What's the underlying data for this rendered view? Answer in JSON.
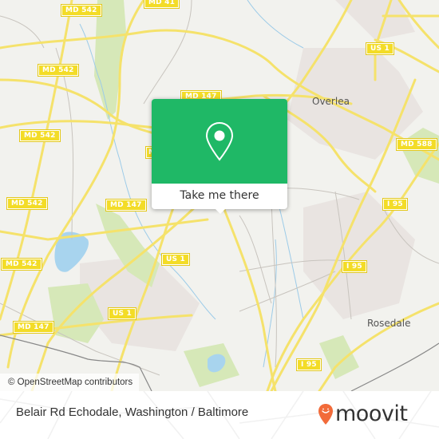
{
  "map": {
    "colors": {
      "background": "#f2f2ee",
      "road_major": "#f5e26b",
      "road_minor": "#c8c4be",
      "park": "#d6e8b8",
      "water": "#a8d4ee",
      "urban": "#e9e4e1"
    },
    "shields": [
      {
        "label": "MD 542"
      },
      {
        "label": "MD 41"
      },
      {
        "label": "MD 542"
      },
      {
        "label": "MD 147"
      },
      {
        "label": "US 1"
      },
      {
        "label": "MD 542"
      },
      {
        "label": "MD 588"
      },
      {
        "label": "MD 542"
      },
      {
        "label": "MD 147"
      },
      {
        "label": "I 95"
      },
      {
        "label": "US 1"
      },
      {
        "label": "MD 542"
      },
      {
        "label": "I 95"
      },
      {
        "label": "US 1"
      },
      {
        "label": "MD 147"
      },
      {
        "label": "I 95"
      },
      {
        "label": "MD 147"
      }
    ],
    "places": [
      {
        "label": "Overlea"
      },
      {
        "label": "Rosedale"
      }
    ],
    "attribution": "© OpenStreetMap contributors"
  },
  "popup": {
    "icon": "map-pin-icon",
    "cta_label": "Take me there",
    "accent_color": "#1fb866"
  },
  "footer": {
    "title": "Belair Rd Echodale, Washington / Baltimore",
    "logo_text": "moovit",
    "logo_icon": "moovit-pin-smile-icon",
    "logo_color": "#f26b3a"
  }
}
